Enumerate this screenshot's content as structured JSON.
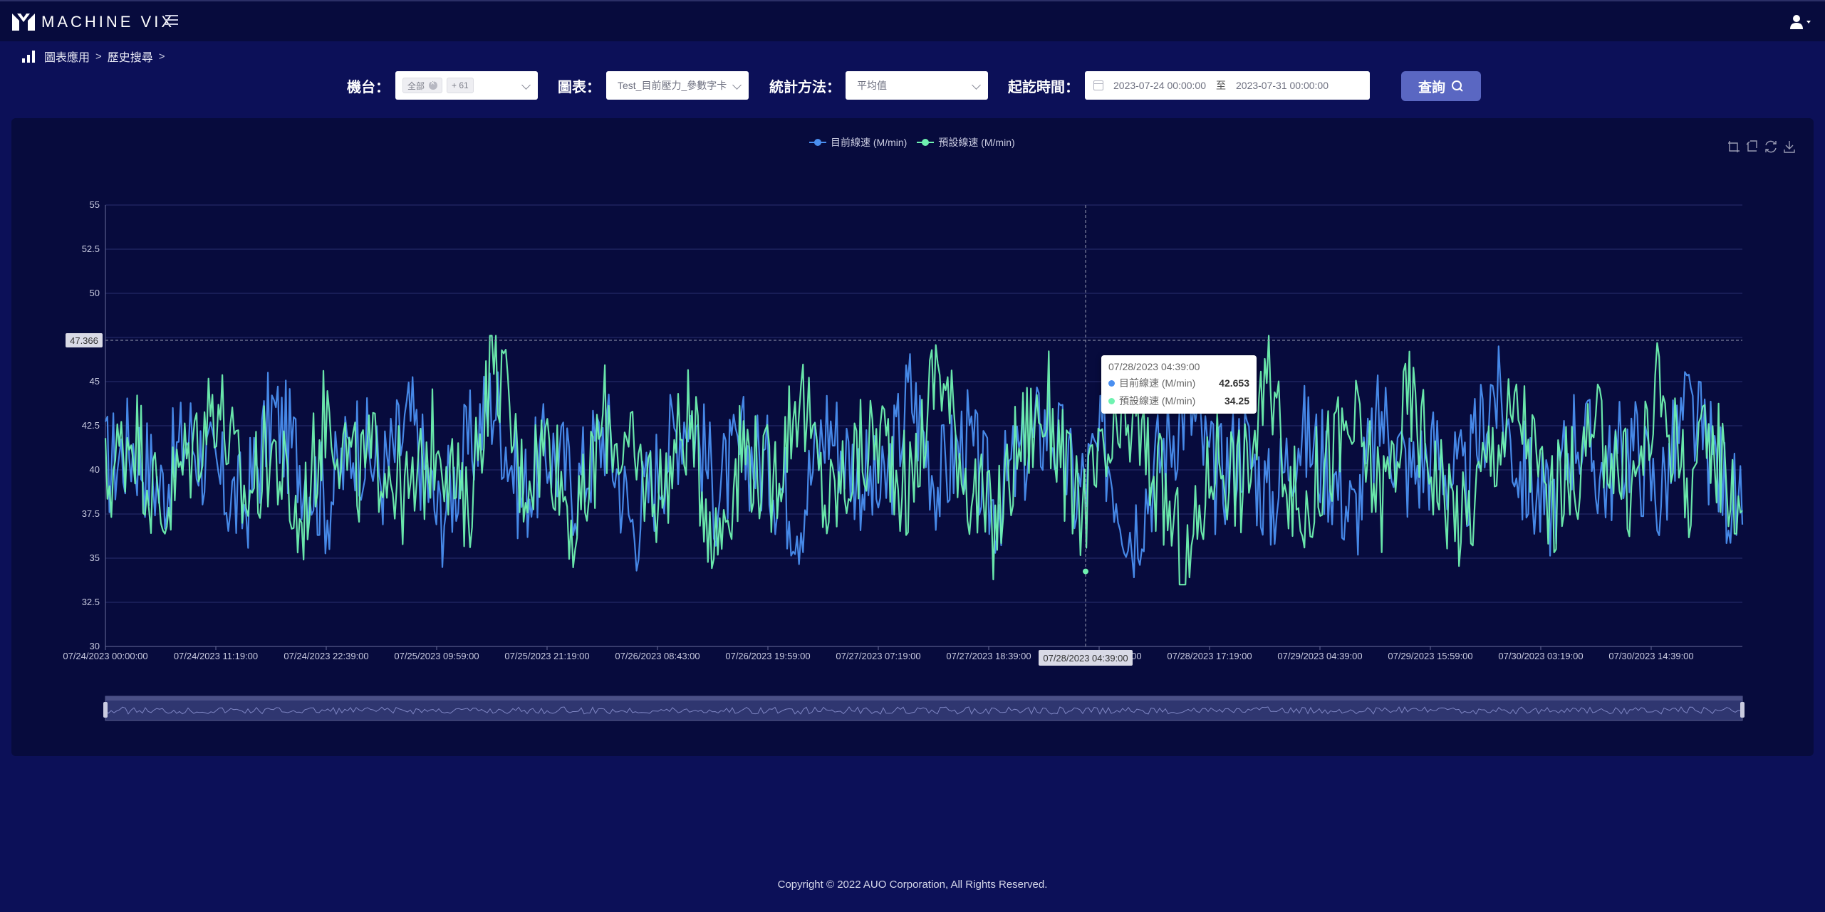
{
  "app": {
    "logo_text": "MACHINE VIX"
  },
  "breadcrumb": {
    "items": [
      "圖表應用",
      "歷史搜尋"
    ],
    "separator": ">"
  },
  "filters": {
    "machine_label": "機台：",
    "machine_tag": "全部",
    "machine_more": "+ 61",
    "chart_label": "圖表：",
    "chart_value": "Test_目前壓力_參數字卡",
    "method_label": "統計方法：",
    "method_value": "平均值",
    "time_label": "起訖時間：",
    "time_start": "2023-07-24 00:00:00",
    "time_sep": "至",
    "time_end": "2023-07-31 00:00:00",
    "search_label": "查詢"
  },
  "colors": {
    "series1": "#4a8ff0",
    "series2": "#6ff2b0",
    "primary_button": "#5a67c2",
    "background": "#0c1058",
    "panel": "#070b3d"
  },
  "chart_data": {
    "type": "line",
    "legend_position": "top-center",
    "grid": true,
    "ylim": [
      30,
      55
    ],
    "y_ticks": [
      "30",
      "32.5",
      "35",
      "37.5",
      "40",
      "42.5",
      "45",
      "47.5",
      "50",
      "52.5",
      "55"
    ],
    "x_tick_labels": [
      "07/24/2023 00:00:00",
      "07/24/2023 11:19:00",
      "07/24/2023 22:39:00",
      "07/25/2023 09:59:00",
      "07/25/2023 21:19:00",
      "07/26/2023 08:43:00",
      "07/26/2023 19:59:00",
      "07/27/2023 07:19:00",
      "07/27/2023 18:39:00",
      "07/28/2023 05:59:00",
      "07/28/2023 17:19:00",
      "07/29/2023 04:39:00",
      "07/29/2023 15:59:00",
      "07/30/2023 03:19:00",
      "07/30/2023 14:39:00"
    ],
    "x_start": "07/24/2023 00:00:00",
    "x_end": "07/30/2023 23:59:00",
    "series": [
      {
        "name": "目前線速 (M/min)",
        "values": [
          40.2,
          41.5,
          38.9,
          42.1,
          39.4,
          37.8,
          43.2,
          40.6,
          38.1,
          41.9,
          39.7,
          42.8,
          37.2,
          40.9,
          44.1,
          38.5,
          41.2,
          39.0,
          42.4,
          36.8,
          40.3,
          43.6,
          38.7,
          41.1,
          39.9,
          37.5,
          42.7,
          40.1,
          38.3,
          44.5,
          39.2,
          41.8,
          37.9,
          40.7,
          42.9,
          38.6,
          41.4,
          36.5,
          40.8,
          43.9,
          39.3,
          41.6,
          38.0,
          42.2,
          40.4,
          37.3,
          43.1,
          39.8,
          41.0,
          38.8,
          44.8,
          40.0,
          37.6,
          42.5,
          39.5,
          41.7,
          38.4,
          43.4,
          40.5,
          36.9
        ]
      },
      {
        "name": "預設線速 (M/min)",
        "values": [
          39.1,
          42.6,
          37.4,
          40.8,
          44.2,
          38.2,
          41.3,
          36.6,
          43.7,
          39.6,
          40.9,
          38.0,
          42.3,
          37.1,
          47.3,
          39.4,
          41.8,
          36.2,
          43.0,
          40.2,
          38.7,
          42.9,
          35.9,
          41.5,
          39.0,
          44.6,
          37.8,
          40.4,
          42.0,
          38.5,
          46.3,
          39.8,
          36.4,
          41.9,
          43.5,
          37.6,
          40.1,
          42.7,
          38.9,
          34.25,
          41.2,
          39.3,
          45.1,
          37.0,
          40.6,
          42.4,
          38.3,
          44.0,
          39.7,
          36.8,
          41.4,
          43.3,
          37.9,
          40.0,
          42.1,
          38.6,
          44.7,
          39.2,
          41.6,
          37.7
        ]
      }
    ],
    "marker_value_label": "47.366",
    "axis_pointer_label": "07/28/2023 04:39:00"
  },
  "tooltip": {
    "time": "07/28/2023 04:39:00",
    "rows": [
      {
        "name": "目前線速 (M/min)",
        "value": "42.653"
      },
      {
        "name": "預設線速 (M/min)",
        "value": "34.25"
      }
    ]
  },
  "footer": {
    "copyright": "Copyright © 2022 AUO Corporation, All Rights Reserved."
  }
}
